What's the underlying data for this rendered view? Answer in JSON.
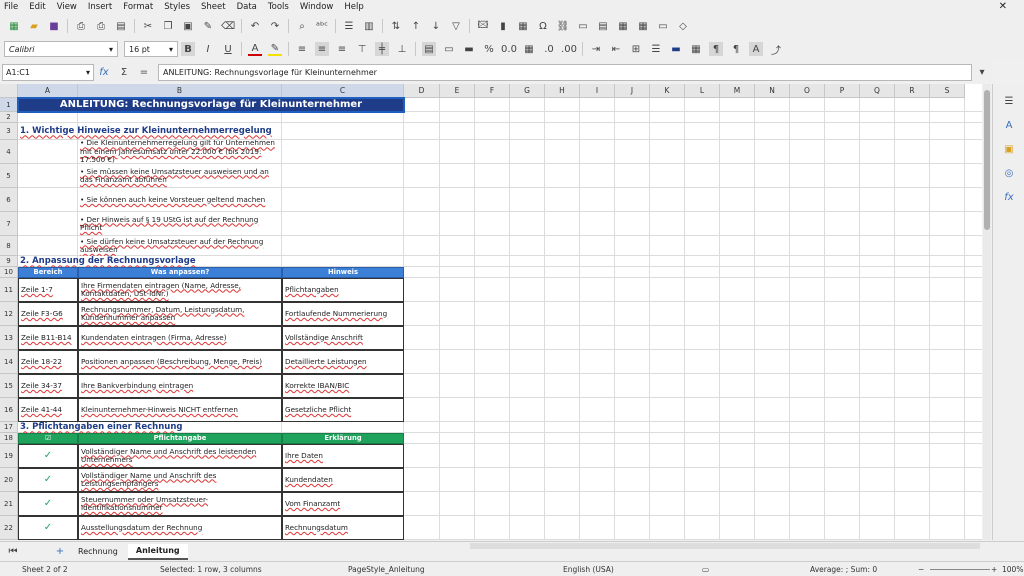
{
  "menu": [
    "File",
    "Edit",
    "View",
    "Insert",
    "Format",
    "Styles",
    "Sheet",
    "Data",
    "Tools",
    "Window",
    "Help"
  ],
  "font": {
    "name": "Calibri",
    "size": "16 pt"
  },
  "namebox": "A1:C1",
  "formula": "ANLEITUNG: Rechnungsvorlage für Kleinunternehmer",
  "columns": [
    "A",
    "B",
    "C",
    "D",
    "E",
    "F",
    "G",
    "H",
    "I",
    "J",
    "K",
    "L",
    "M",
    "N",
    "O",
    "P",
    "Q",
    "R",
    "S"
  ],
  "rows": [
    "1",
    "2",
    "3",
    "4",
    "5",
    "6",
    "7",
    "8",
    "9",
    "10",
    "11",
    "12",
    "13",
    "14",
    "15",
    "16",
    "17",
    "18",
    "19",
    "20",
    "21",
    "22"
  ],
  "sheet": {
    "title": "ANLEITUNG: Rechnungsvorlage für Kleinunternehmer",
    "section1": "1. Wichtige Hinweise zur Kleinunternehmerregelung",
    "bullets": [
      "• Die Kleinunternehmerregelung gilt für Unternehmen mit einem Jahresumsatz unter 22.000 € (bis 2019: 17.500 €)",
      "• Sie müssen keine Umsatzsteuer ausweisen und an das Finanzamt abführen",
      "• Sie können auch keine Vorsteuer geltend machen",
      "• Der Hinweis auf § 19 UStG ist auf der Rechnung Pflicht",
      "• Sie dürfen keine Umsatzsteuer auf der Rechnung ausweisen"
    ],
    "section2": "2. Anpassung der Rechnungsvorlage",
    "t2_head": [
      "Bereich",
      "Was anpassen?",
      "Hinweis"
    ],
    "t2_rows": [
      [
        "Zeile 1-7",
        "Ihre Firmendaten eintragen (Name, Adresse, Kontaktdaten, USt-IdNr.)",
        "Pflichtangaben"
      ],
      [
        "Zeile F3-G6",
        "Rechnungsnummer, Datum, Leistungsdatum, Kundennummer anpassen",
        "Fortlaufende Nummerierung"
      ],
      [
        "Zeile B11-B14",
        "Kundendaten eintragen (Firma, Adresse)",
        "Vollständige Anschrift"
      ],
      [
        "Zeile 18-22",
        "Positionen anpassen (Beschreibung, Menge, Preis)",
        "Detaillierte Leistungen"
      ],
      [
        "Zeile 34-37",
        "Ihre Bankverbindung eintragen",
        "Korrekte IBAN/BIC"
      ],
      [
        "Zeile 41-44",
        "Kleinunternehmer-Hinweis NICHT entfernen",
        "Gesetzliche Pflicht"
      ]
    ],
    "section3": "3. Pflichtangaben einer Rechnung",
    "t3_head": [
      "☑",
      "Pflichtangabe",
      "Erklärung"
    ],
    "t3_rows": [
      [
        "✓",
        "Vollständiger Name und Anschrift des leistenden Unternehmers",
        "Ihre Daten"
      ],
      [
        "✓",
        "Vollständiger Name und Anschrift des Leistungsempfängers",
        "Kundendaten"
      ],
      [
        "✓",
        "Steuernummer oder Umsatzsteuer-Identifikationsnummer",
        "Vom Finanzamt"
      ],
      [
        "✓",
        "Ausstellungsdatum der Rechnung",
        "Rechnungsdatum"
      ]
    ]
  },
  "tabs": [
    "Rechnung",
    "Anleitung"
  ],
  "status": {
    "sheet": "Sheet 2 of 2",
    "selected": "Selected: 1 row, 3 columns",
    "pagestyle": "PageStyle_Anleitung",
    "lang": "English (USA)",
    "sum": "Average: ; Sum: 0",
    "zoom": "100%"
  },
  "colors": {
    "title_bg": "#1f3c88",
    "blue_head": "#3c7fd6",
    "green_head": "#1fa35c",
    "section": "#1f3c88"
  }
}
